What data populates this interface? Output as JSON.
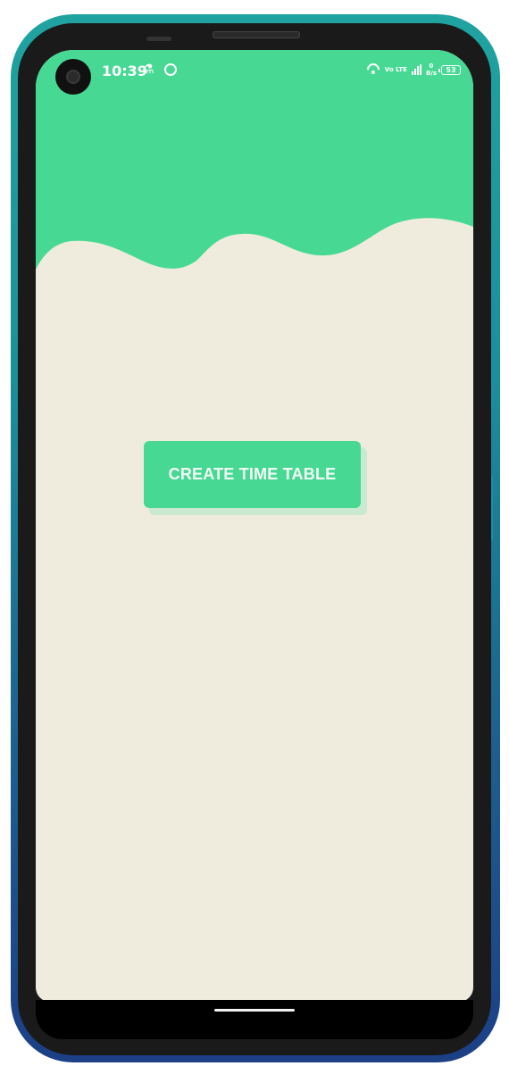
{
  "status_bar": {
    "time": "10:39",
    "network_label": "Vo LTE",
    "speed_value": "0",
    "speed_unit": "B/s",
    "battery_level": "53"
  },
  "main": {
    "create_button_label": "CREATE TIME TABLE"
  },
  "colors": {
    "header_green": "#47d994",
    "background_cream": "#f0ecdd",
    "button_green": "#47d994",
    "frame_teal": "#1fa3a0",
    "frame_blue": "#1c3f86"
  },
  "icons": [
    "camera-icon",
    "flask-icon",
    "sync-icon",
    "wifi-icon",
    "signal-icon",
    "battery-icon"
  ]
}
